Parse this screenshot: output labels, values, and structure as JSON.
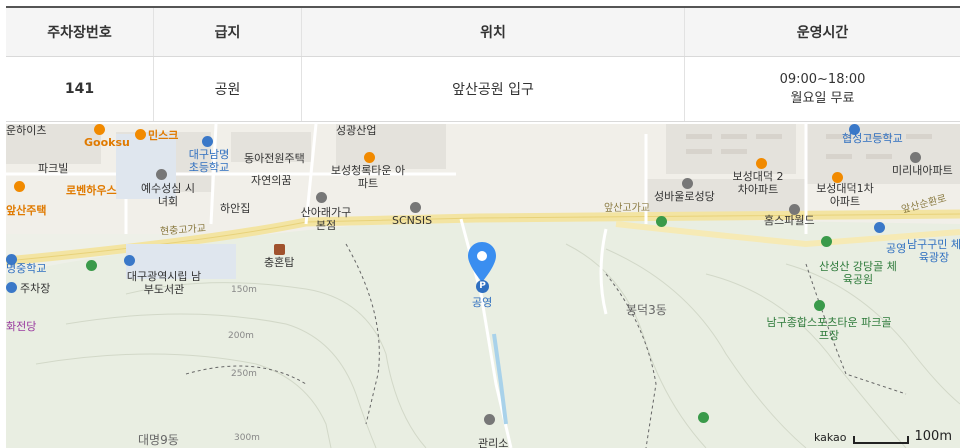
{
  "table": {
    "headers": [
      "주차장번호",
      "급지",
      "위치",
      "운영시간"
    ],
    "row": {
      "number": "141",
      "grade": "공원",
      "location": "앞산공원 입구",
      "hours_line1": "09:00~18:00",
      "hours_line2": "월요일 무료"
    }
  },
  "map": {
    "marker_label": "공영",
    "parking_symbol": "P",
    "scale_brand": "kakao",
    "scale_distance": "100m",
    "labels": {
      "l1": "운하이츠",
      "l2": "Gooksu",
      "l3": "민스크",
      "l4": "성광산업",
      "l5": "협성고등학교",
      "l6": "파크빌",
      "l7": "대구남명 초등학교",
      "l8": "동아전원주택",
      "l9": "보성청록타운 아파트",
      "l10": "성바울로성당",
      "l11": "보성대덕 2차아파트",
      "l12": "보성대덕1차 아파트",
      "l13": "미리내아파트",
      "l14": "로벤하우스",
      "l15": "예수성심 시녀회",
      "l16": "자연의꿈",
      "l17": "앞산주택",
      "l18": "하안집",
      "l19": "산아래가구 본점",
      "l20": "SCNSIS",
      "l21": "앞산고가교",
      "l22": "홈스파월드",
      "l23": "앞산순환로",
      "l24": "현충고가교",
      "l25": "공영",
      "l26": "남구구민 체육광장",
      "l27": "명중학교",
      "l28": "대구광역시립 남부도서관",
      "l29": "충혼탑",
      "l30": "산성산 강당골 체육공원",
      "l31": "주차장",
      "l32": "화전당",
      "l33": "150m",
      "l34": "봉덕3동",
      "l35": "남구종합스포츠타운 파크골프장",
      "l36": "200m",
      "l37": "250m",
      "l38": "대명9동",
      "l39": "300m",
      "l40": "관리소"
    }
  }
}
